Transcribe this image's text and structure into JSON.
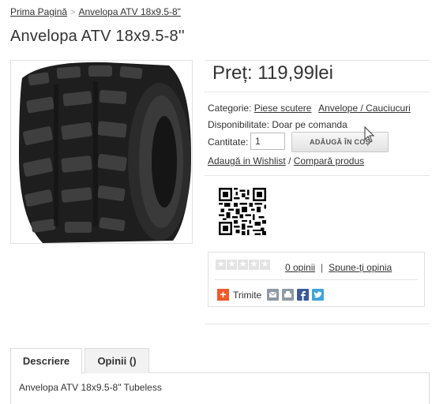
{
  "breadcrumb": {
    "home": "Prima Pagină",
    "separator": ">",
    "current": "Anvelopa ATV 18x9.5-8\""
  },
  "product": {
    "title": "Anvelopa ATV 18x9.5-8''",
    "price": "Preț: 119,99lei",
    "category_label": "Categorie:",
    "category_links": [
      "Piese scutere",
      "Anvelope / Cauciucuri"
    ],
    "availability_label": "Disponibilitate:",
    "availability_value": "Doar pe comanda",
    "quantity_label": "Cantitate:",
    "quantity_value": "1",
    "add_to_cart": "ADĂUGĂ ÎN COȘ",
    "wishlist": "Adaugă in Wishlist",
    "links_separator": "/",
    "compare": "Compară produs"
  },
  "reviews": {
    "rating": 0,
    "max_rating": 5,
    "count_link": "0 opinii",
    "separator": "|",
    "write_link": "Spune-ți opinia"
  },
  "share": {
    "label": "Trimite",
    "icons": [
      "email-icon",
      "print-icon",
      "facebook-icon",
      "twitter-icon"
    ]
  },
  "tabs": [
    {
      "label": "Descriere",
      "active": true
    },
    {
      "label": "Opinii ()",
      "active": false
    }
  ],
  "description": "Anvelopa ATV 18x9.5-8\" Tubeless",
  "colors": {
    "orange": "#f05a2a",
    "facebook": "#3b5998",
    "twitter": "#41a4d8",
    "grey_icon": "#8e9aa4"
  }
}
